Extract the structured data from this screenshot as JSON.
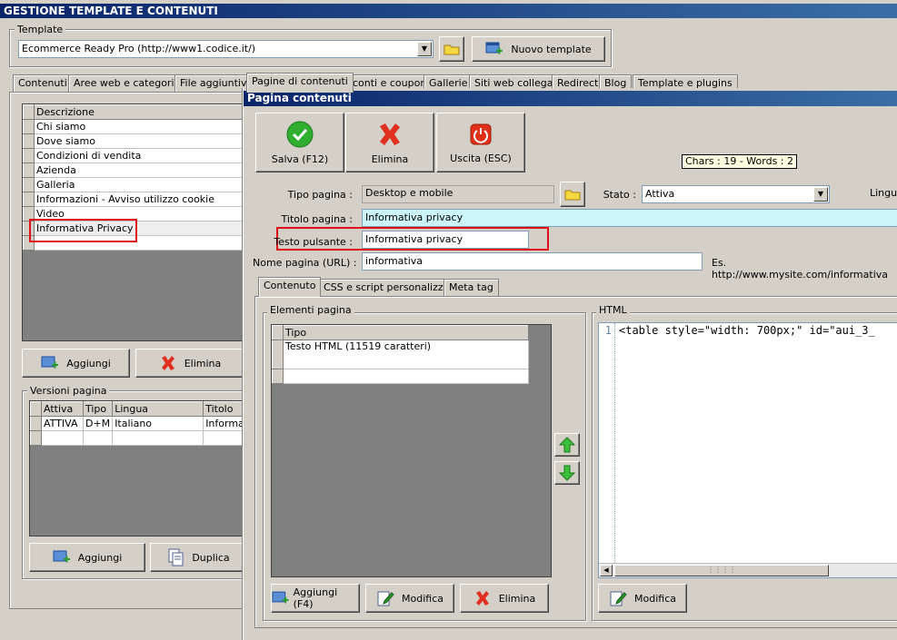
{
  "main_window": {
    "title": "GESTIONE TEMPLATE E CONTENUTI"
  },
  "template_group": {
    "label": "Template",
    "selected": "Ecommerce Ready Pro (http://www1.codice.it/)",
    "new_template_label": "Nuovo template"
  },
  "main_tabs": [
    "Contenuti",
    "Aree web e categorie",
    "File aggiuntivi",
    "Pagine di contenuti",
    "Sconti e coupon",
    "Gallerie",
    "Siti web collegati",
    "Redirect",
    "Blog",
    "Template e plugins"
  ],
  "pages_grid": {
    "header": "Descrizione",
    "rows": [
      "Chi siamo",
      "Dove siamo",
      "Condizioni di vendita",
      "Azienda",
      "Galleria",
      "Informazioni - Avviso utilizzo cookie",
      "Video",
      "Informativa Privacy"
    ]
  },
  "pages_buttons": {
    "add": "Aggiungi",
    "delete": "Elimina"
  },
  "versions": {
    "label": "Versioni pagina",
    "columns": [
      "Attiva",
      "Tipo",
      "Lingua",
      "Titolo"
    ],
    "rows": [
      [
        "ATTIVA",
        "D+M",
        "Italiano",
        "Informa"
      ]
    ],
    "add": "Aggiungi",
    "duplicate": "Duplica"
  },
  "dialog": {
    "title": "Pagina contenuti",
    "toolbar": {
      "save": "Salva (F12)",
      "delete": "Elimina",
      "exit": "Uscita (ESC)"
    },
    "chars_words": "Chars : 19 - Words : 2",
    "page_type_label": "Tipo pagina :",
    "page_type_value": "Desktop e mobile",
    "state_label": "Stato :",
    "state_value": "Attiva",
    "language_label": "Lingua",
    "title_label": "Titolo pagina :",
    "title_value": "Informativa privacy",
    "button_text_label": "Testo pulsante :",
    "button_text_value": "Informativa privacy",
    "url_label": "Nome pagina (URL) :",
    "url_value": "informativa",
    "url_example": "Es. http://www.mysite.com/informativa",
    "tabs": [
      "Contenuto",
      "CSS e script personalizzati",
      "Meta tag"
    ],
    "elements": {
      "label": "Elementi pagina",
      "header": "Tipo",
      "rows": [
        "Testo HTML (11519 caratteri)"
      ],
      "add": "Aggiungi (F4)",
      "modify": "Modifica",
      "delete": "Elimina"
    },
    "html_panel": {
      "label": "HTML",
      "line_number": "1",
      "code": "<table style=\"width: 700px;\" id=\"aui_3_",
      "modify": "Modifica"
    }
  },
  "colors": {
    "accent_red": "#e0101a",
    "title_field_bg": "#ccf5fa",
    "title_gradient_start": "#0a246a"
  }
}
